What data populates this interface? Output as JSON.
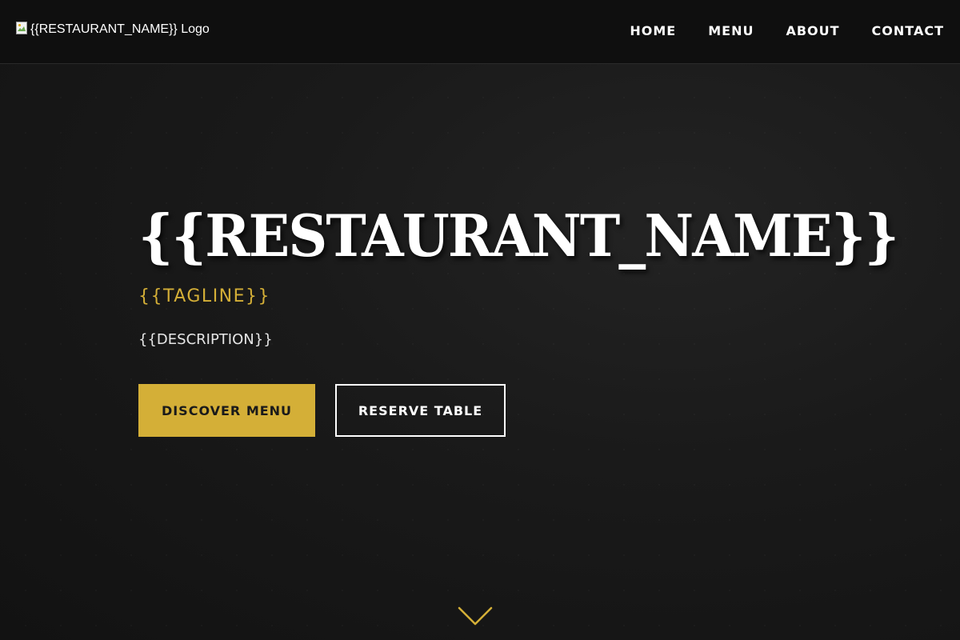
{
  "header": {
    "logo_alt": "{{RESTAURANT_NAME}} Logo",
    "nav": [
      {
        "label": "HOME"
      },
      {
        "label": "MENU"
      },
      {
        "label": "ABOUT"
      },
      {
        "label": "CONTACT"
      }
    ]
  },
  "hero": {
    "title": "{{RESTAURANT_NAME}}",
    "tagline": "{{TAGLINE}}",
    "description": "{{DESCRIPTION}}",
    "primary_button": "DISCOVER MENU",
    "secondary_button": "RESERVE TABLE"
  },
  "icons": {
    "logo": "broken-image-icon",
    "scroll": "chevron-down-icon"
  },
  "colors": {
    "accent": "#d4af37",
    "background": "#141414",
    "header_background": "#0f0f0f",
    "text": "#ffffff"
  }
}
